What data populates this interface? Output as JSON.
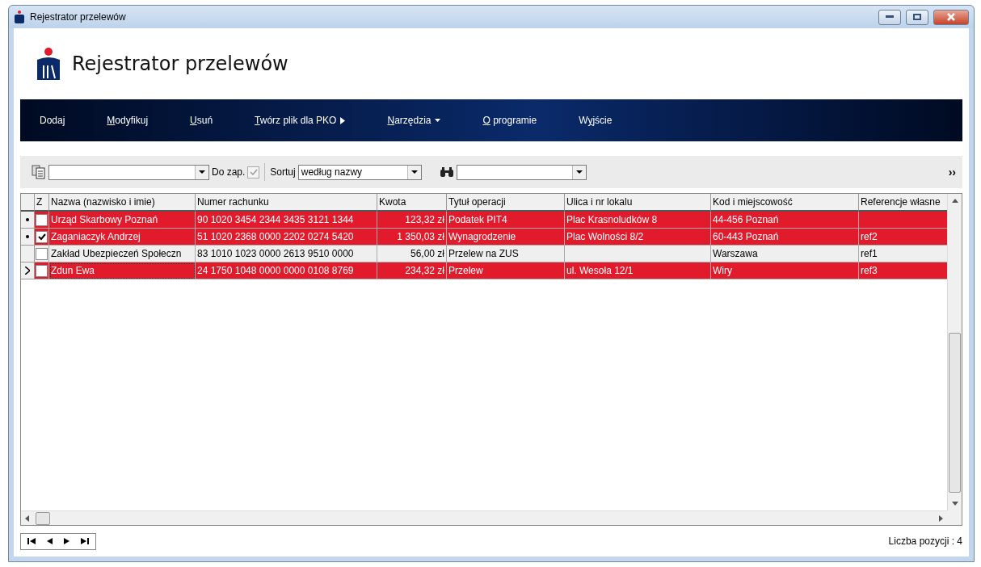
{
  "window": {
    "title": "Rejestrator przelewów"
  },
  "header": {
    "title": "Rejestrator przelewów"
  },
  "menu": [
    {
      "before": "Doda",
      "key": "j",
      "kind": "plain"
    },
    {
      "key": "M",
      "after": "odyfikuj",
      "kind": "plain"
    },
    {
      "key": "U",
      "after": "suń",
      "kind": "plain"
    },
    {
      "key": "T",
      "after": "wórz plik dla PKO",
      "kind": "submenu"
    },
    {
      "key": "N",
      "after": "arzędzia",
      "kind": "dropdown"
    },
    {
      "key": "O",
      "after": " programie",
      "kind": "plain"
    },
    {
      "before": "W",
      "key": "y",
      "after": "jście",
      "kind": "plain"
    }
  ],
  "toolbar": {
    "do_zap": {
      "label": "Do zap.",
      "checked": true
    },
    "sort": {
      "label": "Sortuj",
      "value": "według nazwy"
    },
    "more": "››"
  },
  "table": {
    "check_column": "Z",
    "columns": [
      "Nazwa (nazwisko i imie)",
      "Numer rachunku",
      "Kwota",
      "Tytuł operacji",
      "Ulica i nr lokalu",
      "Kod i miejscowość",
      "Referencje własne"
    ],
    "rows": [
      {
        "marked": true,
        "current": false,
        "checked": false,
        "highlighted": true,
        "cells": [
          "Urząd Skarbowy Poznań",
          "90 1020 3454 2344 3435 3121 1344",
          "123,32 zł",
          "Podatek PIT4",
          "Plac Krasnoludków 8",
          "44-456 Poznań",
          ""
        ]
      },
      {
        "marked": true,
        "current": false,
        "checked": true,
        "highlighted": true,
        "cells": [
          "Zaganiaczyk Andrzej",
          "51 1020 2368 0000 2202 0274 5420",
          "1 350,03 zł",
          "Wynagrodzenie",
          "Plac Wolności 8/2",
          "60-443 Poznań",
          "ref2"
        ]
      },
      {
        "marked": false,
        "current": false,
        "checked": false,
        "highlighted": false,
        "cells": [
          "Zakład Ubezpieczeń Społeczn",
          "83 1010 1023 0000 2613 9510 0000",
          "56,00 zł",
          "Przelew na ZUS",
          "",
          "Warszawa",
          "ref1"
        ]
      },
      {
        "marked": false,
        "current": true,
        "checked": false,
        "highlighted": true,
        "cells": [
          "Zdun Ewa",
          "24 1750 1048 0000 0000 0108 8769",
          "234,32 zł",
          "Przelew",
          "ul. Wesoła 12/1",
          "Wiry",
          "ref3"
        ]
      }
    ]
  },
  "status": {
    "count": "Liczba pozycji : 4"
  }
}
